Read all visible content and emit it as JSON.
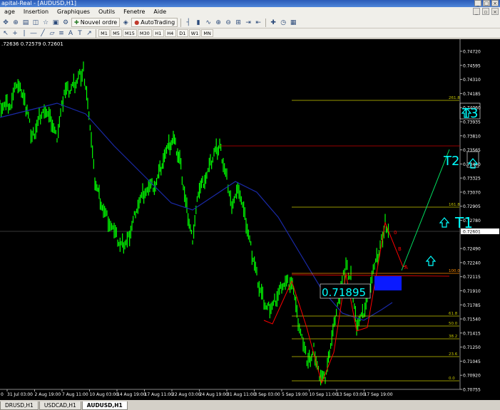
{
  "window": {
    "title": "apital-Real - [AUDUSD,H1]",
    "controls": [
      "_",
      "□",
      "×"
    ]
  },
  "menu": {
    "items": [
      "age",
      "Insertion",
      "Graphiques",
      "Outils",
      "Fenetre",
      "Aide"
    ],
    "right_controls": [
      "_",
      "▫",
      "×"
    ]
  },
  "toolbar": {
    "new_order_label": "Nouvel ordre",
    "autotrading_label": "AutoTrading"
  },
  "timeframes": [
    "M1",
    "M5",
    "M15",
    "M30",
    "H1",
    "H4",
    "D1",
    "W1",
    "MN"
  ],
  "chart": {
    "info_line": ".72636 0.72579 0.72601",
    "price_labels": [
      "0.74720",
      "0.74595",
      "0.74310",
      "0.74185",
      "0.74060",
      "0.73935",
      "0.73810",
      "0.73565",
      "0.73440",
      "0.73325",
      "0.73070",
      "0.72905",
      "0.72780",
      "0.72601",
      "0.72490",
      "0.72240",
      "0.72115",
      "0.71910",
      "0.71785",
      "0.71540",
      "0.71415",
      "0.71250",
      "0.71045",
      "0.70920",
      "0.70755"
    ],
    "time_labels": [
      "31 Jul 03:00",
      "2 Aug 19:00",
      "7 Aug 11:00",
      "10 Aug 03:00",
      "14 Aug 19:00",
      "17 Aug 11:00",
      "22 Aug 03:00",
      "24 Aug 19:00",
      "31 Aug 11:00",
      "3 Sep 03:00",
      "5 Sep 19:00",
      "10 Sep 11:00",
      "13 Sep 03:00",
      "17 Sep 19:00"
    ],
    "time_label_left": "0",
    "fib_labels": [
      "261.8",
      "161.8",
      "100.0",
      "61.8",
      "50.0",
      "38.2",
      "23.6",
      "0.0"
    ],
    "current_price_label": "0.72601",
    "entry_price_label": "0.71895",
    "target_labels": [
      "T1",
      "T2",
      "T3"
    ],
    "wave_labels": [
      "0",
      "B",
      "A"
    ],
    "colors": {
      "candles": "#00ff00",
      "moving_average": "#1a2aa8",
      "fib": "#c8c800",
      "fib_100": "#ff8c00",
      "zigzag": "#ff0000",
      "target": "#00ffff",
      "entry_zone": "#0a1aff"
    }
  },
  "tabs": [
    "DRUSD,H1",
    "USDCAD,H1",
    "AUDUSD,H1"
  ],
  "active_tab": "AUDUSD,H1"
}
